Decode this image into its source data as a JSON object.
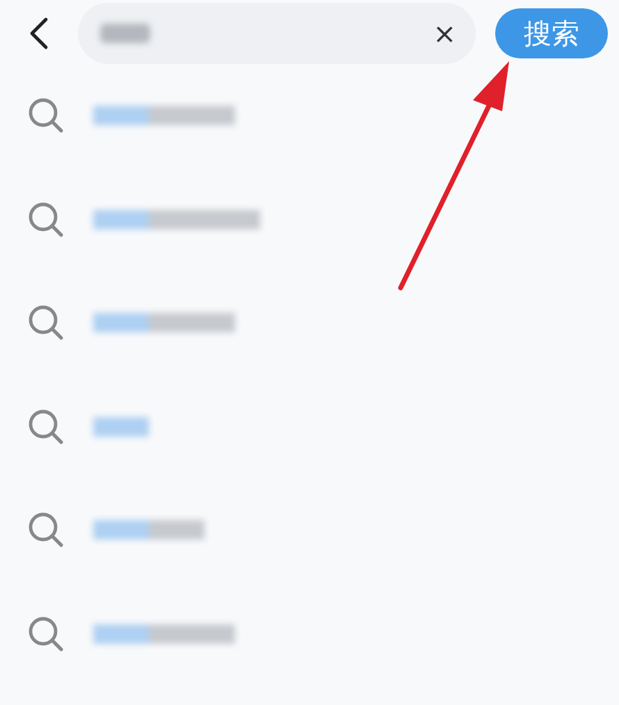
{
  "search_bar": {
    "query_blurred": true,
    "clear": "×",
    "button": "搜索"
  },
  "suggestions": [
    {
      "blurred": true
    },
    {
      "blurred": true
    },
    {
      "blurred": true
    },
    {
      "blurred": true
    },
    {
      "blurred": true
    },
    {
      "blurred": true
    }
  ],
  "annotations": [
    {
      "kind": "arrow"
    }
  ]
}
